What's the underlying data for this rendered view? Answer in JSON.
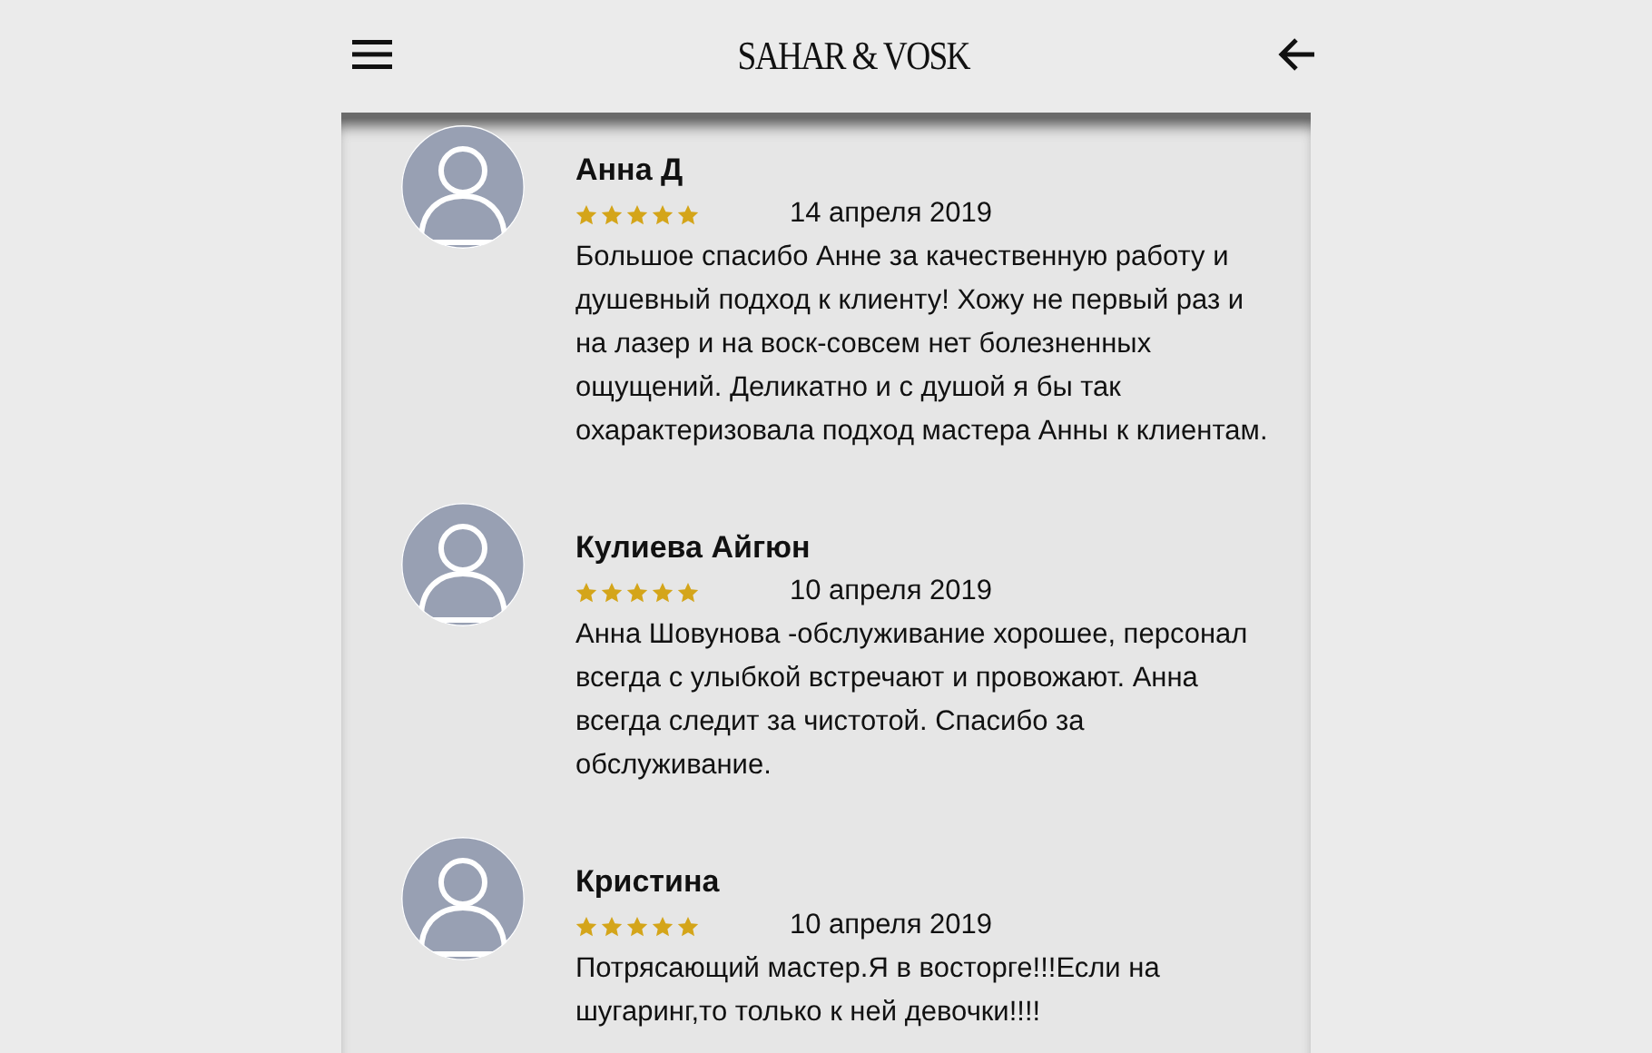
{
  "header": {
    "logo": "SAHAR & VOSK"
  },
  "reviews": [
    {
      "name": "Анна Д",
      "stars": 5,
      "date": "14 апреля 2019",
      "text": "Большое спасибо Анне за качественную работу и душевный подход к клиенту! Хожу не первый раз и на лазер и на воск-совсем нет болезненных ощущений. Деликатно и с душой я бы так охарактеризовала подход мастера Анны к клиентам."
    },
    {
      "name": "Кулиева Айгюн",
      "stars": 5,
      "date": "10 апреля 2019",
      "text": "Анна Шовунова -обслуживание хорошее, персонал всегда с улыбкой встречают и провожают. Анна всегда следит за чистотой. Спасибо за обслуживание."
    },
    {
      "name": "Кристина",
      "stars": 5,
      "date": "10 апреля 2019",
      "text": "Потрясающий мастер.Я в восторге!!!Если на шугаринг,то только к ней девочки!!!!"
    }
  ]
}
